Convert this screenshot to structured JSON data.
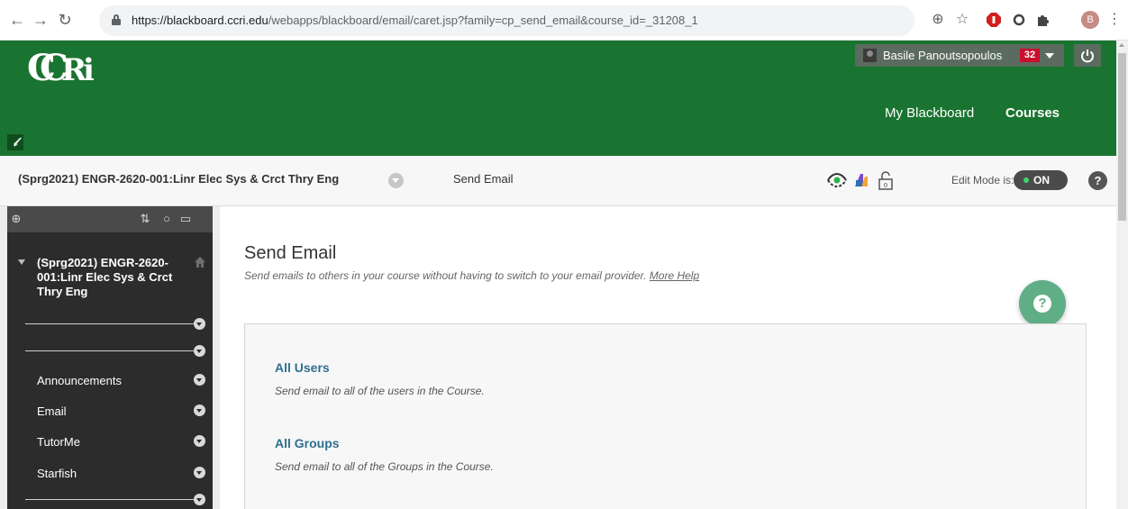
{
  "browser": {
    "url_host": "https://blackboard.ccri.edu",
    "url_path": "/webapps/blackboard/email/caret.jsp?family=cp_send_email&course_id=_31208_1",
    "profile_initial": "B",
    "icons": [
      "back-icon",
      "forward-icon",
      "reload-icon",
      "lock-icon",
      "zoom-icon",
      "star-icon",
      "adblock-icon",
      "extension-icon",
      "puzzle-icon",
      "menu-icon"
    ]
  },
  "header": {
    "logo_text": "CCRI",
    "user_name": "Basile Panoutsopoulos",
    "notification_count": "32",
    "nav": [
      "My Blackboard",
      "Courses"
    ],
    "brand_color": "#1a7431"
  },
  "breadcrumb": {
    "course": "(Sprg2021) ENGR-2620-001:Linr Elec Sys & Crct Thry Eng",
    "page": "Send Email",
    "edit_mode_label": "Edit Mode is:",
    "edit_mode_value": "ON"
  },
  "sidebar": {
    "course_title": "(Sprg2021) ENGR-2620-001:Linr Elec Sys & Crct Thry Eng",
    "items": [
      "Announcements",
      "Email",
      "TutorMe",
      "Starfish"
    ]
  },
  "main": {
    "title": "Send Email",
    "description": "Send emails to others in your course without having to switch to your email provider.",
    "more_help": "More Help",
    "options": [
      {
        "title": "All Users",
        "description": "Send email to all of the users in the Course."
      },
      {
        "title": "All Groups",
        "description": "Send email to all of the Groups in the Course."
      }
    ]
  }
}
